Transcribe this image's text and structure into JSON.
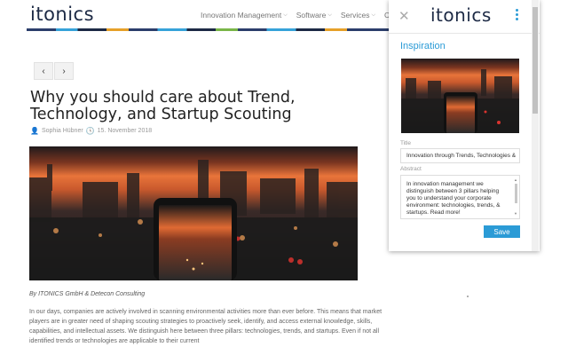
{
  "site": {
    "logo_text": "itonics",
    "nav": [
      {
        "label": "Innovation Management",
        "chevron": "chevron-down-icon"
      },
      {
        "label": "Software",
        "chevron": "chevron-down-icon"
      },
      {
        "label": "Services",
        "chevron": "chevron-down-icon"
      },
      {
        "label": "C",
        "chevron": ""
      }
    ]
  },
  "article": {
    "prev_label": "‹",
    "next_label": "›",
    "title": "Why you should care about Trend, Technology, and Startup Scouting",
    "author": "Sophia Hübner",
    "date": "15. November 2018",
    "credit": "By ITONICS GmbH & Detecon Consulting",
    "body": "In our days, companies are actively involved in scanning environmental activities more than ever before. This means that market players are in greater need of shaping scouting strategies to proactively seek, identify, and access external knowledge, skills, capabilities, and intellectual assets. We distinguish here between three pillars: technologies, trends, and startups. Even if not all identified trends or technologies are applicable to their current"
  },
  "popup": {
    "close_label": "✕",
    "logo_text": "itonics",
    "heading": "Inspiration",
    "title_label": "Title",
    "title_value": "Innovation through Trends, Technologies &",
    "abstract_label": "Abstract",
    "abstract_value": "In innovation management we distinguish between 3 pillars helping you to understand your corporate environment: technologies, trends, & startups. Read more!",
    "save_label": "Save"
  },
  "colors": {
    "brand_navy": "#1d2a45",
    "accent_blue": "#2b9bd6"
  }
}
